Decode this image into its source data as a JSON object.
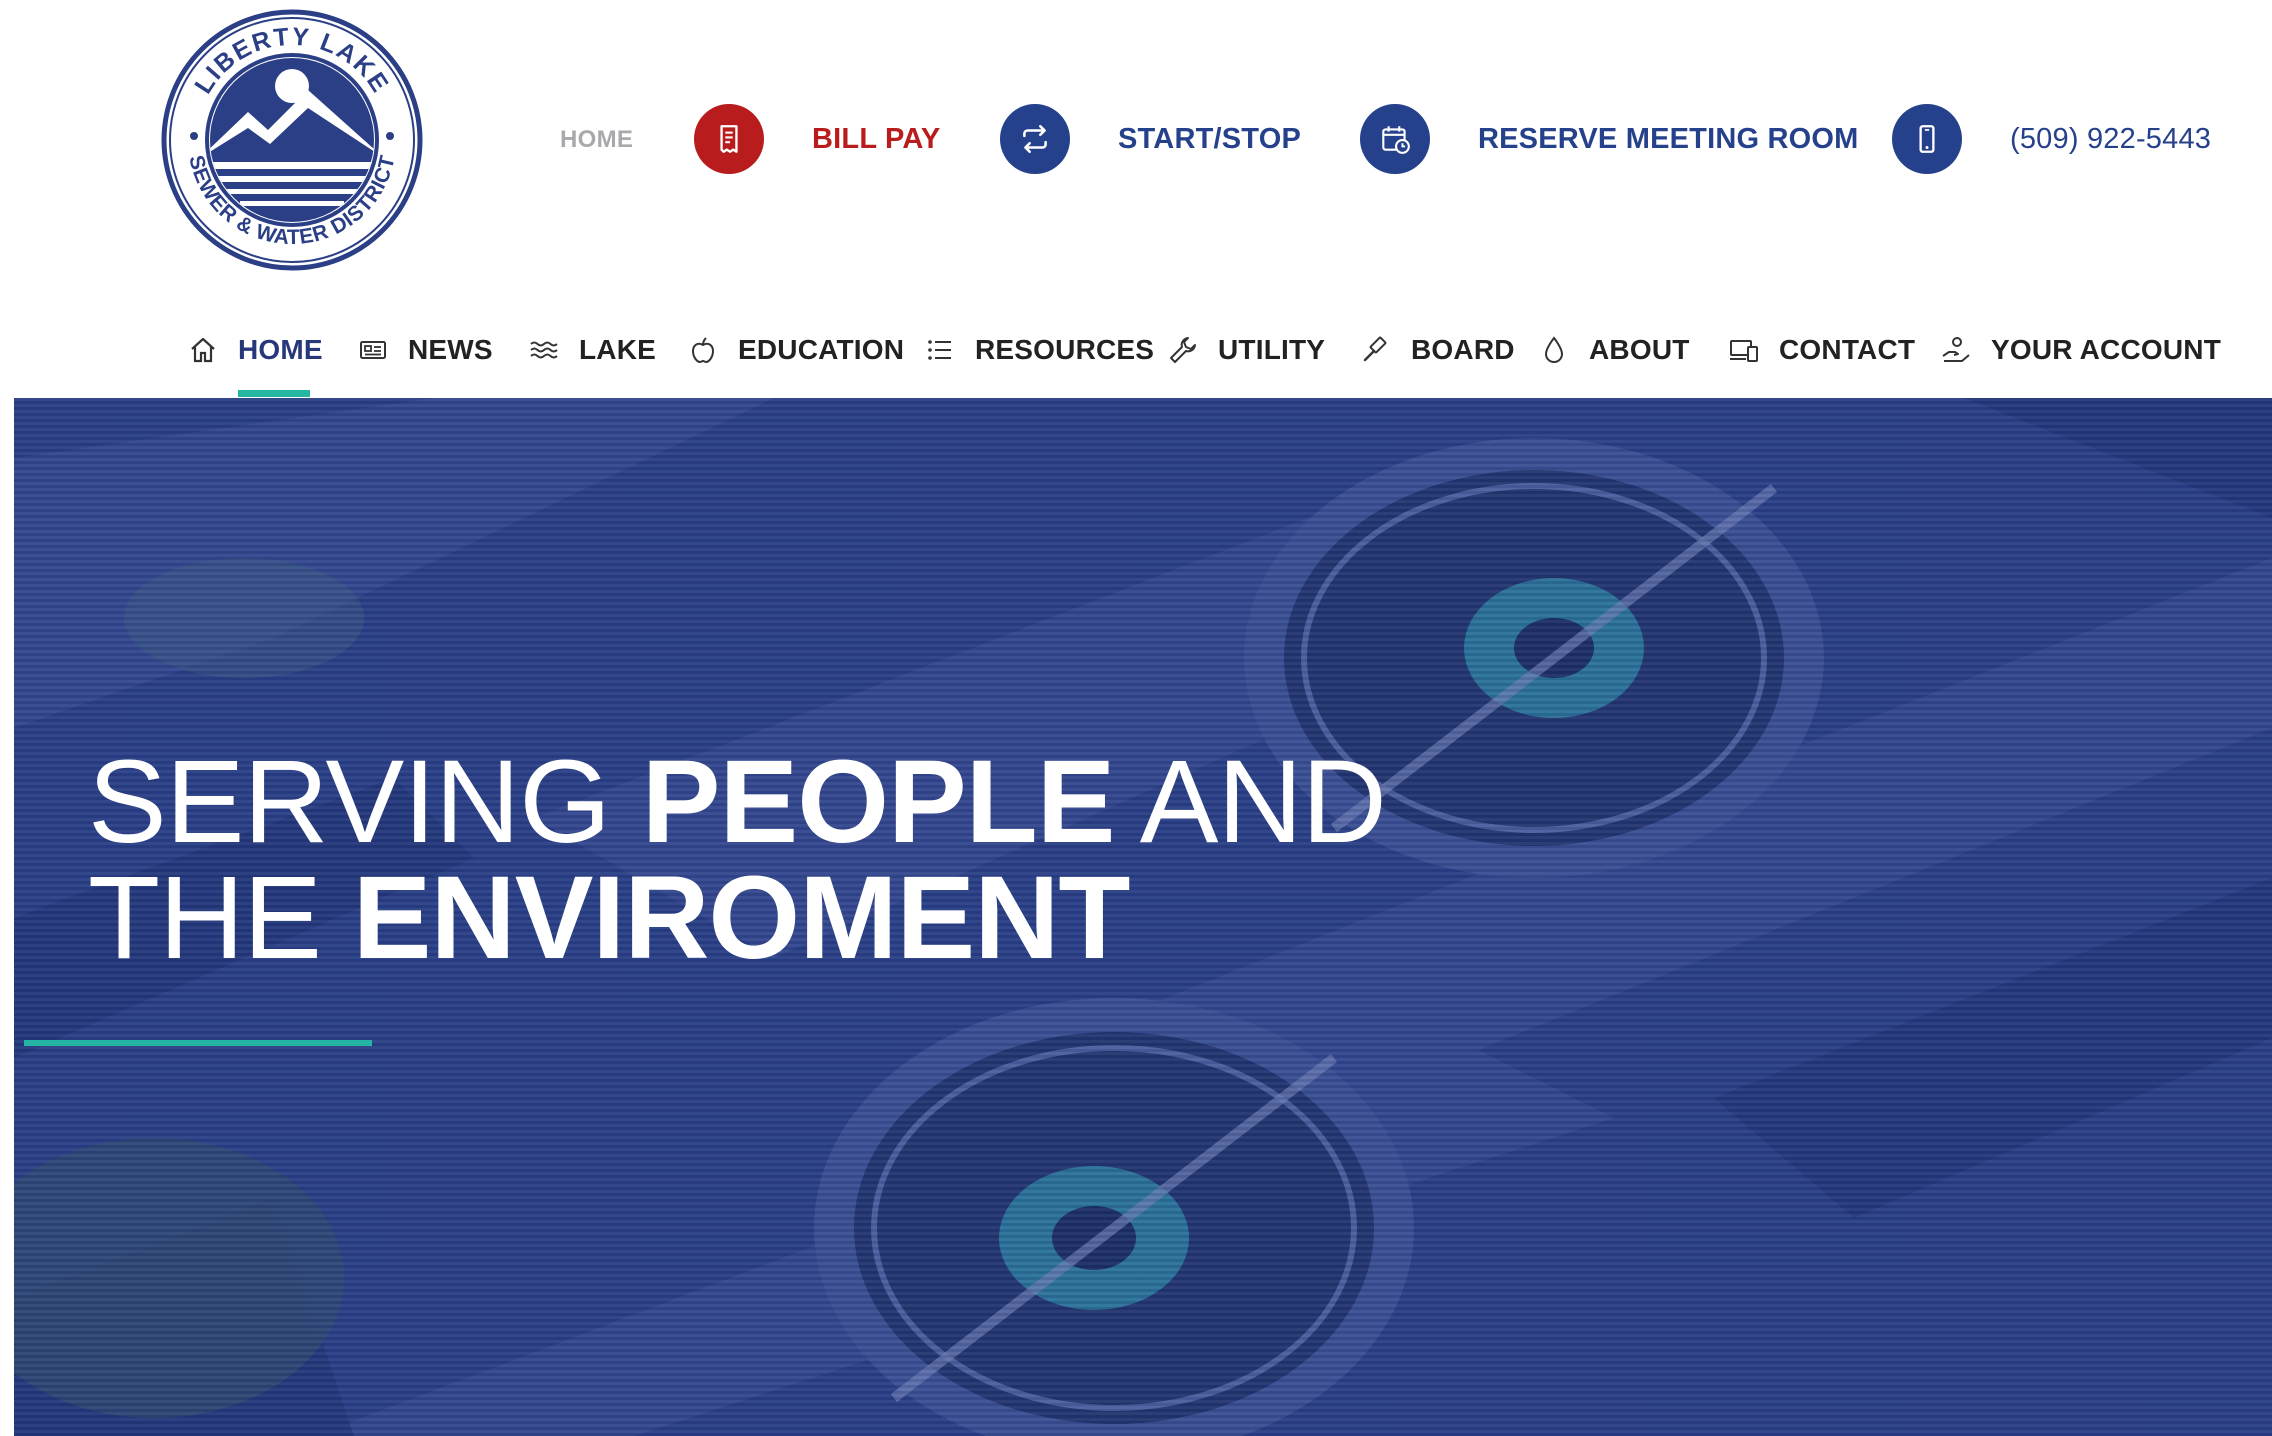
{
  "logo": {
    "ring_top_text": "LIBERTY LAKE",
    "ring_bottom_text": "SEWER & WATER DISTRICT"
  },
  "utility_bar": {
    "home": "HOME",
    "bill_pay": {
      "label": "BILL PAY",
      "icon": "receipt-icon",
      "color": "#b81c1c"
    },
    "start_stop": {
      "label": "START/STOP",
      "icon": "swap-arrows-icon",
      "color": "#26418b"
    },
    "reserve": {
      "label": "RESERVE MEETING ROOM",
      "icon": "calendar-clock-icon",
      "color": "#26418b"
    },
    "phone": {
      "label": "(509) 922-5443",
      "icon": "smartphone-icon",
      "color": "#26418b"
    }
  },
  "nav": {
    "items": [
      {
        "label": "HOME",
        "icon": "home-icon",
        "active": true
      },
      {
        "label": "NEWS",
        "icon": "newspaper-icon"
      },
      {
        "label": "LAKE",
        "icon": "waves-icon"
      },
      {
        "label": "EDUCATION",
        "icon": "apple-icon"
      },
      {
        "label": "RESOURCES",
        "icon": "list-icon"
      },
      {
        "label": "UTILITY",
        "icon": "wrench-icon"
      },
      {
        "label": "BOARD",
        "icon": "gavel-icon"
      },
      {
        "label": "ABOUT",
        "icon": "water-drop-icon"
      },
      {
        "label": "CONTACT",
        "icon": "devices-icon"
      },
      {
        "label": "YOUR ACCOUNT",
        "icon": "hand-coin-icon"
      }
    ],
    "accent_color": "#26b7a2"
  },
  "hero": {
    "line1_light": "SERVING ",
    "line1_bold": "PEOPLE",
    "line1_light2": " AND",
    "line2_light": "THE ",
    "line2_bold": "ENVIROMENT",
    "overlay_color": "#2a3f86",
    "accent_color": "#25b4a3"
  }
}
